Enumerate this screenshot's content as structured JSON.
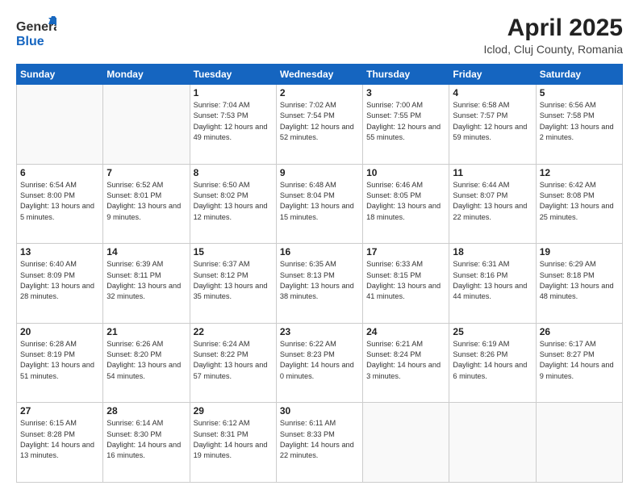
{
  "header": {
    "logo_line1": "General",
    "logo_line2": "Blue",
    "month": "April 2025",
    "location": "Iclod, Cluj County, Romania"
  },
  "days_of_week": [
    "Sunday",
    "Monday",
    "Tuesday",
    "Wednesday",
    "Thursday",
    "Friday",
    "Saturday"
  ],
  "weeks": [
    [
      {
        "day": "",
        "info": ""
      },
      {
        "day": "",
        "info": ""
      },
      {
        "day": "1",
        "info": "Sunrise: 7:04 AM\nSunset: 7:53 PM\nDaylight: 12 hours\nand 49 minutes."
      },
      {
        "day": "2",
        "info": "Sunrise: 7:02 AM\nSunset: 7:54 PM\nDaylight: 12 hours\nand 52 minutes."
      },
      {
        "day": "3",
        "info": "Sunrise: 7:00 AM\nSunset: 7:55 PM\nDaylight: 12 hours\nand 55 minutes."
      },
      {
        "day": "4",
        "info": "Sunrise: 6:58 AM\nSunset: 7:57 PM\nDaylight: 12 hours\nand 59 minutes."
      },
      {
        "day": "5",
        "info": "Sunrise: 6:56 AM\nSunset: 7:58 PM\nDaylight: 13 hours\nand 2 minutes."
      }
    ],
    [
      {
        "day": "6",
        "info": "Sunrise: 6:54 AM\nSunset: 8:00 PM\nDaylight: 13 hours\nand 5 minutes."
      },
      {
        "day": "7",
        "info": "Sunrise: 6:52 AM\nSunset: 8:01 PM\nDaylight: 13 hours\nand 9 minutes."
      },
      {
        "day": "8",
        "info": "Sunrise: 6:50 AM\nSunset: 8:02 PM\nDaylight: 13 hours\nand 12 minutes."
      },
      {
        "day": "9",
        "info": "Sunrise: 6:48 AM\nSunset: 8:04 PM\nDaylight: 13 hours\nand 15 minutes."
      },
      {
        "day": "10",
        "info": "Sunrise: 6:46 AM\nSunset: 8:05 PM\nDaylight: 13 hours\nand 18 minutes."
      },
      {
        "day": "11",
        "info": "Sunrise: 6:44 AM\nSunset: 8:07 PM\nDaylight: 13 hours\nand 22 minutes."
      },
      {
        "day": "12",
        "info": "Sunrise: 6:42 AM\nSunset: 8:08 PM\nDaylight: 13 hours\nand 25 minutes."
      }
    ],
    [
      {
        "day": "13",
        "info": "Sunrise: 6:40 AM\nSunset: 8:09 PM\nDaylight: 13 hours\nand 28 minutes."
      },
      {
        "day": "14",
        "info": "Sunrise: 6:39 AM\nSunset: 8:11 PM\nDaylight: 13 hours\nand 32 minutes."
      },
      {
        "day": "15",
        "info": "Sunrise: 6:37 AM\nSunset: 8:12 PM\nDaylight: 13 hours\nand 35 minutes."
      },
      {
        "day": "16",
        "info": "Sunrise: 6:35 AM\nSunset: 8:13 PM\nDaylight: 13 hours\nand 38 minutes."
      },
      {
        "day": "17",
        "info": "Sunrise: 6:33 AM\nSunset: 8:15 PM\nDaylight: 13 hours\nand 41 minutes."
      },
      {
        "day": "18",
        "info": "Sunrise: 6:31 AM\nSunset: 8:16 PM\nDaylight: 13 hours\nand 44 minutes."
      },
      {
        "day": "19",
        "info": "Sunrise: 6:29 AM\nSunset: 8:18 PM\nDaylight: 13 hours\nand 48 minutes."
      }
    ],
    [
      {
        "day": "20",
        "info": "Sunrise: 6:28 AM\nSunset: 8:19 PM\nDaylight: 13 hours\nand 51 minutes."
      },
      {
        "day": "21",
        "info": "Sunrise: 6:26 AM\nSunset: 8:20 PM\nDaylight: 13 hours\nand 54 minutes."
      },
      {
        "day": "22",
        "info": "Sunrise: 6:24 AM\nSunset: 8:22 PM\nDaylight: 13 hours\nand 57 minutes."
      },
      {
        "day": "23",
        "info": "Sunrise: 6:22 AM\nSunset: 8:23 PM\nDaylight: 14 hours\nand 0 minutes."
      },
      {
        "day": "24",
        "info": "Sunrise: 6:21 AM\nSunset: 8:24 PM\nDaylight: 14 hours\nand 3 minutes."
      },
      {
        "day": "25",
        "info": "Sunrise: 6:19 AM\nSunset: 8:26 PM\nDaylight: 14 hours\nand 6 minutes."
      },
      {
        "day": "26",
        "info": "Sunrise: 6:17 AM\nSunset: 8:27 PM\nDaylight: 14 hours\nand 9 minutes."
      }
    ],
    [
      {
        "day": "27",
        "info": "Sunrise: 6:15 AM\nSunset: 8:28 PM\nDaylight: 14 hours\nand 13 minutes."
      },
      {
        "day": "28",
        "info": "Sunrise: 6:14 AM\nSunset: 8:30 PM\nDaylight: 14 hours\nand 16 minutes."
      },
      {
        "day": "29",
        "info": "Sunrise: 6:12 AM\nSunset: 8:31 PM\nDaylight: 14 hours\nand 19 minutes."
      },
      {
        "day": "30",
        "info": "Sunrise: 6:11 AM\nSunset: 8:33 PM\nDaylight: 14 hours\nand 22 minutes."
      },
      {
        "day": "",
        "info": ""
      },
      {
        "day": "",
        "info": ""
      },
      {
        "day": "",
        "info": ""
      }
    ]
  ]
}
